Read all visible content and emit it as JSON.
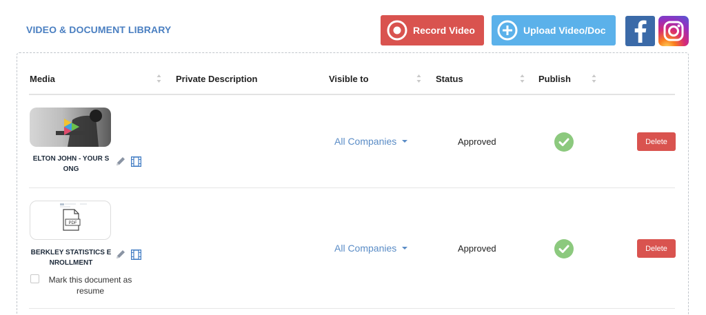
{
  "library": {
    "title": "VIDEO & DOCUMENT LIBRARY",
    "record_label": "Record Video",
    "upload_label": "Upload Video/Doc",
    "record_color": "#d9534f",
    "upload_color": "#5bb1ea"
  },
  "social": {
    "facebook_icon": "facebook-icon",
    "instagram_icon": "instagram-icon"
  },
  "table": {
    "columns": [
      "Media",
      "Private Description",
      "Visible to",
      "Status",
      "Publish"
    ],
    "rows": [
      {
        "media_title": "ELTON JOHN - YOUR S ONG",
        "media_type": "video",
        "description": "",
        "visible_to": "All Companies",
        "status": "Approved",
        "published": true,
        "delete_label": "Delete"
      },
      {
        "media_title": "BERKLEY STATISTICS E NROLLMENT",
        "media_type": "pdf",
        "thumb_badge": "PDF",
        "description": "",
        "visible_to": "All Companies",
        "status": "Approved",
        "published": true,
        "delete_label": "Delete",
        "resume_label": "Mark this document as resume",
        "resume_checked": false
      }
    ]
  }
}
